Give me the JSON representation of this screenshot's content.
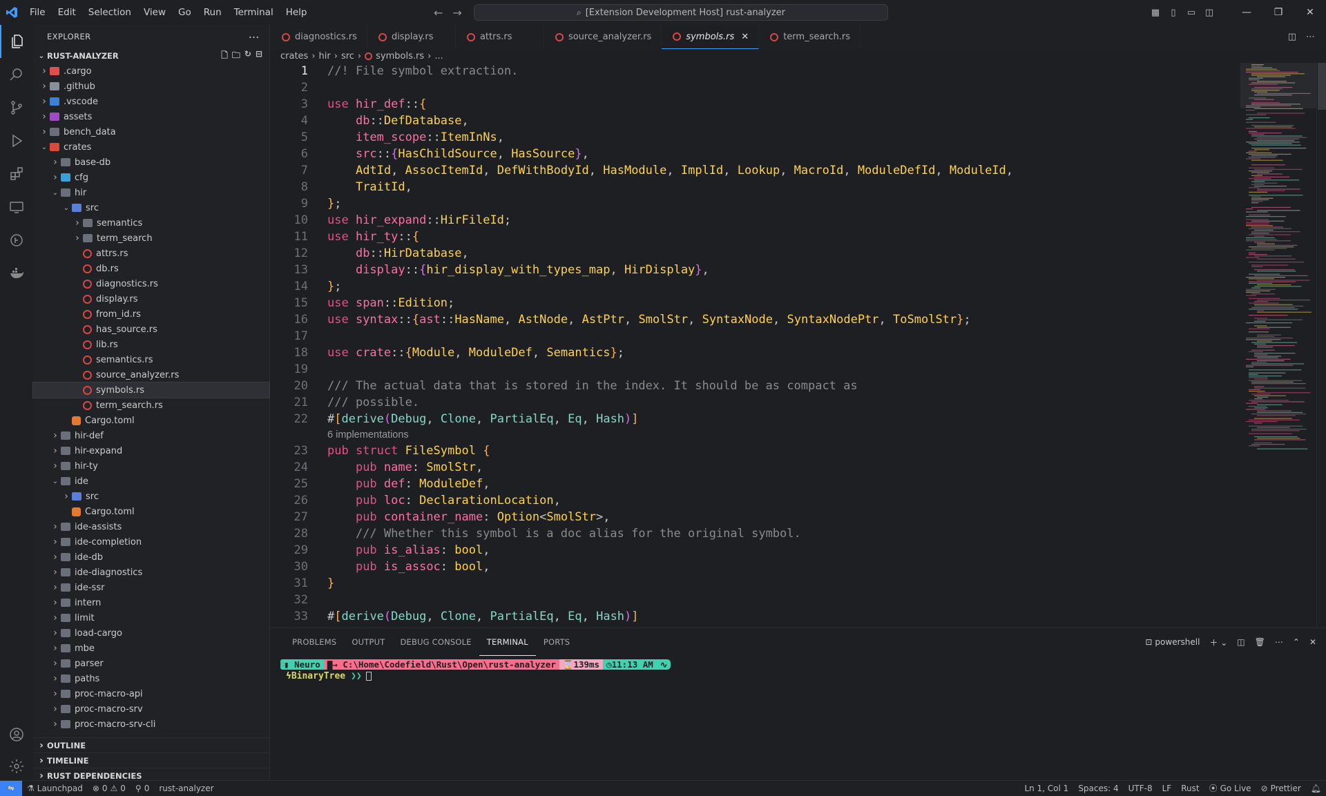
{
  "titlebar": {
    "menu": [
      "File",
      "Edit",
      "Selection",
      "View",
      "Go",
      "Run",
      "Terminal",
      "Help"
    ],
    "command_center": "[Extension Development Host] rust-analyzer"
  },
  "explorer": {
    "title": "EXPLORER",
    "root": "RUST-ANALYZER",
    "items": [
      {
        "label": ".cargo",
        "depth": 0,
        "kind": "folder",
        "open": false,
        "icon": "cargo"
      },
      {
        "label": ".github",
        "depth": 0,
        "kind": "folder",
        "open": false,
        "icon": "github"
      },
      {
        "label": ".vscode",
        "depth": 0,
        "kind": "folder",
        "open": false,
        "icon": "vscode"
      },
      {
        "label": "assets",
        "depth": 0,
        "kind": "folder",
        "open": false,
        "icon": "assets"
      },
      {
        "label": "bench_data",
        "depth": 0,
        "kind": "folder",
        "open": false,
        "icon": ""
      },
      {
        "label": "crates",
        "depth": 0,
        "kind": "folder",
        "open": true,
        "icon": "crates"
      },
      {
        "label": "base-db",
        "depth": 1,
        "kind": "folder",
        "open": false,
        "icon": ""
      },
      {
        "label": "cfg",
        "depth": 1,
        "kind": "folder",
        "open": false,
        "icon": "cfg"
      },
      {
        "label": "hir",
        "depth": 1,
        "kind": "folder",
        "open": true,
        "icon": ""
      },
      {
        "label": "src",
        "depth": 2,
        "kind": "folder",
        "open": true,
        "icon": "src"
      },
      {
        "label": "semantics",
        "depth": 3,
        "kind": "folder",
        "open": false,
        "icon": ""
      },
      {
        "label": "term_search",
        "depth": 3,
        "kind": "folder",
        "open": false,
        "icon": ""
      },
      {
        "label": "attrs.rs",
        "depth": 3,
        "kind": "rs"
      },
      {
        "label": "db.rs",
        "depth": 3,
        "kind": "rs"
      },
      {
        "label": "diagnostics.rs",
        "depth": 3,
        "kind": "rs"
      },
      {
        "label": "display.rs",
        "depth": 3,
        "kind": "rs"
      },
      {
        "label": "from_id.rs",
        "depth": 3,
        "kind": "rs"
      },
      {
        "label": "has_source.rs",
        "depth": 3,
        "kind": "rs"
      },
      {
        "label": "lib.rs",
        "depth": 3,
        "kind": "rs"
      },
      {
        "label": "semantics.rs",
        "depth": 3,
        "kind": "rs"
      },
      {
        "label": "source_analyzer.rs",
        "depth": 3,
        "kind": "rs"
      },
      {
        "label": "symbols.rs",
        "depth": 3,
        "kind": "rs",
        "selected": true
      },
      {
        "label": "term_search.rs",
        "depth": 3,
        "kind": "rs"
      },
      {
        "label": "Cargo.toml",
        "depth": 2,
        "kind": "toml"
      },
      {
        "label": "hir-def",
        "depth": 1,
        "kind": "folder",
        "open": false,
        "icon": ""
      },
      {
        "label": "hir-expand",
        "depth": 1,
        "kind": "folder",
        "open": false,
        "icon": ""
      },
      {
        "label": "hir-ty",
        "depth": 1,
        "kind": "folder",
        "open": false,
        "icon": ""
      },
      {
        "label": "ide",
        "depth": 1,
        "kind": "folder",
        "open": true,
        "icon": ""
      },
      {
        "label": "src",
        "depth": 2,
        "kind": "folder",
        "open": false,
        "icon": "src"
      },
      {
        "label": "Cargo.toml",
        "depth": 2,
        "kind": "toml"
      },
      {
        "label": "ide-assists",
        "depth": 1,
        "kind": "folder",
        "open": false,
        "icon": ""
      },
      {
        "label": "ide-completion",
        "depth": 1,
        "kind": "folder",
        "open": false,
        "icon": ""
      },
      {
        "label": "ide-db",
        "depth": 1,
        "kind": "folder",
        "open": false,
        "icon": ""
      },
      {
        "label": "ide-diagnostics",
        "depth": 1,
        "kind": "folder",
        "open": false,
        "icon": ""
      },
      {
        "label": "ide-ssr",
        "depth": 1,
        "kind": "folder",
        "open": false,
        "icon": ""
      },
      {
        "label": "intern",
        "depth": 1,
        "kind": "folder",
        "open": false,
        "icon": ""
      },
      {
        "label": "limit",
        "depth": 1,
        "kind": "folder",
        "open": false,
        "icon": ""
      },
      {
        "label": "load-cargo",
        "depth": 1,
        "kind": "folder",
        "open": false,
        "icon": ""
      },
      {
        "label": "mbe",
        "depth": 1,
        "kind": "folder",
        "open": false,
        "icon": ""
      },
      {
        "label": "parser",
        "depth": 1,
        "kind": "folder",
        "open": false,
        "icon": ""
      },
      {
        "label": "paths",
        "depth": 1,
        "kind": "folder",
        "open": false,
        "icon": ""
      },
      {
        "label": "proc-macro-api",
        "depth": 1,
        "kind": "folder",
        "open": false,
        "icon": ""
      },
      {
        "label": "proc-macro-srv",
        "depth": 1,
        "kind": "folder",
        "open": false,
        "icon": ""
      },
      {
        "label": "proc-macro-srv-cli",
        "depth": 1,
        "kind": "folder",
        "open": false,
        "icon": ""
      }
    ],
    "bottom_sections": [
      "OUTLINE",
      "TIMELINE",
      "RUST DEPENDENCIES"
    ]
  },
  "tabs": [
    {
      "label": "diagnostics.rs",
      "active": false
    },
    {
      "label": "display.rs",
      "active": false
    },
    {
      "label": "attrs.rs",
      "active": false
    },
    {
      "label": "source_analyzer.rs",
      "active": false
    },
    {
      "label": "symbols.rs",
      "active": true
    },
    {
      "label": "term_search.rs",
      "active": false
    }
  ],
  "breadcrumb": [
    "crates",
    "hir",
    "src",
    "symbols.rs",
    "..."
  ],
  "code_lens": "6 implementations",
  "editor_lines": [
    [
      1,
      [
        [
          "cm",
          "//! File symbol extraction."
        ]
      ]
    ],
    [
      2,
      []
    ],
    [
      3,
      [
        [
          "kw",
          "use "
        ],
        [
          "md",
          "hir_def"
        ],
        [
          "pu",
          "::"
        ],
        [
          "br",
          "{"
        ]
      ]
    ],
    [
      4,
      [
        [
          "pu",
          "    "
        ],
        [
          "md",
          "db"
        ],
        [
          "pu",
          "::"
        ],
        [
          "ty",
          "DefDatabase"
        ],
        [
          "pu",
          ","
        ]
      ]
    ],
    [
      5,
      [
        [
          "pu",
          "    "
        ],
        [
          "md",
          "item_scope"
        ],
        [
          "pu",
          "::"
        ],
        [
          "ty",
          "ItemInNs"
        ],
        [
          "pu",
          ","
        ]
      ]
    ],
    [
      6,
      [
        [
          "pu",
          "    "
        ],
        [
          "md",
          "src"
        ],
        [
          "pu",
          "::"
        ],
        [
          "br2",
          "{"
        ],
        [
          "ty",
          "HasChildSource"
        ],
        [
          "pu",
          ", "
        ],
        [
          "ty",
          "HasSource"
        ],
        [
          "br2",
          "}"
        ],
        [
          "pu",
          ","
        ]
      ]
    ],
    [
      7,
      [
        [
          "pu",
          "    "
        ],
        [
          "ty",
          "AdtId"
        ],
        [
          "pu",
          ", "
        ],
        [
          "ty",
          "AssocItemId"
        ],
        [
          "pu",
          ", "
        ],
        [
          "ty",
          "DefWithBodyId"
        ],
        [
          "pu",
          ", "
        ],
        [
          "ty",
          "HasModule"
        ],
        [
          "pu",
          ", "
        ],
        [
          "ty",
          "ImplId"
        ],
        [
          "pu",
          ", "
        ],
        [
          "ty",
          "Lookup"
        ],
        [
          "pu",
          ", "
        ],
        [
          "ty",
          "MacroId"
        ],
        [
          "pu",
          ", "
        ],
        [
          "ty",
          "ModuleDefId"
        ],
        [
          "pu",
          ", "
        ],
        [
          "ty",
          "ModuleId"
        ],
        [
          "pu",
          ","
        ]
      ]
    ],
    [
      8,
      [
        [
          "pu",
          "    "
        ],
        [
          "ty",
          "TraitId"
        ],
        [
          "pu",
          ","
        ]
      ]
    ],
    [
      9,
      [
        [
          "br",
          "}"
        ],
        [
          "pu",
          ";"
        ]
      ]
    ],
    [
      10,
      [
        [
          "kw",
          "use "
        ],
        [
          "md",
          "hir_expand"
        ],
        [
          "pu",
          "::"
        ],
        [
          "ty",
          "HirFileId"
        ],
        [
          "pu",
          ";"
        ]
      ]
    ],
    [
      11,
      [
        [
          "kw",
          "use "
        ],
        [
          "md",
          "hir_ty"
        ],
        [
          "pu",
          "::"
        ],
        [
          "br",
          "{"
        ]
      ]
    ],
    [
      12,
      [
        [
          "pu",
          "    "
        ],
        [
          "md",
          "db"
        ],
        [
          "pu",
          "::"
        ],
        [
          "ty",
          "HirDatabase"
        ],
        [
          "pu",
          ","
        ]
      ]
    ],
    [
      13,
      [
        [
          "pu",
          "    "
        ],
        [
          "md",
          "display"
        ],
        [
          "pu",
          "::"
        ],
        [
          "br2",
          "{"
        ],
        [
          "fn",
          "hir_display_with_types_map"
        ],
        [
          "pu",
          ", "
        ],
        [
          "ty",
          "HirDisplay"
        ],
        [
          "br2",
          "}"
        ],
        [
          "pu",
          ","
        ]
      ]
    ],
    [
      14,
      [
        [
          "br",
          "}"
        ],
        [
          "pu",
          ";"
        ]
      ]
    ],
    [
      15,
      [
        [
          "kw",
          "use "
        ],
        [
          "md",
          "span"
        ],
        [
          "pu",
          "::"
        ],
        [
          "ty",
          "Edition"
        ],
        [
          "pu",
          ";"
        ]
      ]
    ],
    [
      16,
      [
        [
          "kw",
          "use "
        ],
        [
          "md",
          "syntax"
        ],
        [
          "pu",
          "::"
        ],
        [
          "br",
          "{"
        ],
        [
          "md",
          "ast"
        ],
        [
          "pu",
          "::"
        ],
        [
          "ty",
          "HasName"
        ],
        [
          "pu",
          ", "
        ],
        [
          "ty",
          "AstNode"
        ],
        [
          "pu",
          ", "
        ],
        [
          "ty",
          "AstPtr"
        ],
        [
          "pu",
          ", "
        ],
        [
          "ty",
          "SmolStr"
        ],
        [
          "pu",
          ", "
        ],
        [
          "ty",
          "SyntaxNode"
        ],
        [
          "pu",
          ", "
        ],
        [
          "ty",
          "SyntaxNodePtr"
        ],
        [
          "pu",
          ", "
        ],
        [
          "ty",
          "ToSmolStr"
        ],
        [
          "br",
          "}"
        ],
        [
          "pu",
          ";"
        ]
      ]
    ],
    [
      17,
      []
    ],
    [
      18,
      [
        [
          "kw",
          "use "
        ],
        [
          "md",
          "crate"
        ],
        [
          "pu",
          "::"
        ],
        [
          "br",
          "{"
        ],
        [
          "ty",
          "Module"
        ],
        [
          "pu",
          ", "
        ],
        [
          "ty",
          "ModuleDef"
        ],
        [
          "pu",
          ", "
        ],
        [
          "ty",
          "Semantics"
        ],
        [
          "br",
          "}"
        ],
        [
          "pu",
          ";"
        ]
      ]
    ],
    [
      19,
      []
    ],
    [
      20,
      [
        [
          "cm",
          "/// The actual data that is stored in the index. It should be as compact as"
        ]
      ]
    ],
    [
      21,
      [
        [
          "cm",
          "/// possible."
        ]
      ]
    ],
    [
      22,
      [
        [
          "pu",
          "#"
        ],
        [
          "br",
          "["
        ],
        [
          "at",
          "derive"
        ],
        [
          "br2",
          "("
        ],
        [
          "at",
          "Debug"
        ],
        [
          "pu",
          ", "
        ],
        [
          "at",
          "Clone"
        ],
        [
          "pu",
          ", "
        ],
        [
          "at",
          "PartialEq"
        ],
        [
          "pu",
          ", "
        ],
        [
          "at",
          "Eq"
        ],
        [
          "pu",
          ", "
        ],
        [
          "at",
          "Hash"
        ],
        [
          "br2",
          ")"
        ],
        [
          "br",
          "]"
        ]
      ]
    ],
    [
      23,
      [
        [
          "kw",
          "pub struct "
        ],
        [
          "ty",
          "FileSymbol "
        ],
        [
          "br",
          "{"
        ]
      ]
    ],
    [
      24,
      [
        [
          "pu",
          "    "
        ],
        [
          "kw",
          "pub "
        ],
        [
          "md",
          "name"
        ],
        [
          "pu",
          ": "
        ],
        [
          "ty",
          "SmolStr"
        ],
        [
          "pu",
          ","
        ]
      ]
    ],
    [
      25,
      [
        [
          "pu",
          "    "
        ],
        [
          "kw",
          "pub "
        ],
        [
          "md",
          "def"
        ],
        [
          "pu",
          ": "
        ],
        [
          "ty",
          "ModuleDef"
        ],
        [
          "pu",
          ","
        ]
      ]
    ],
    [
      26,
      [
        [
          "pu",
          "    "
        ],
        [
          "kw",
          "pub "
        ],
        [
          "md",
          "loc"
        ],
        [
          "pu",
          ": "
        ],
        [
          "ty",
          "DeclarationLocation"
        ],
        [
          "pu",
          ","
        ]
      ]
    ],
    [
      27,
      [
        [
          "pu",
          "    "
        ],
        [
          "kw",
          "pub "
        ],
        [
          "md",
          "container_name"
        ],
        [
          "pu",
          ": "
        ],
        [
          "ty",
          "Option"
        ],
        [
          "pu",
          "<"
        ],
        [
          "ty",
          "SmolStr"
        ],
        [
          "pu",
          ">,"
        ]
      ]
    ],
    [
      28,
      [
        [
          "pu",
          "    "
        ],
        [
          "cm",
          "/// Whether this symbol is a doc alias for the original symbol."
        ]
      ]
    ],
    [
      29,
      [
        [
          "pu",
          "    "
        ],
        [
          "kw",
          "pub "
        ],
        [
          "md",
          "is_alias"
        ],
        [
          "pu",
          ": "
        ],
        [
          "ty",
          "bool"
        ],
        [
          "pu",
          ","
        ]
      ]
    ],
    [
      30,
      [
        [
          "pu",
          "    "
        ],
        [
          "kw",
          "pub "
        ],
        [
          "md",
          "is_assoc"
        ],
        [
          "pu",
          ": "
        ],
        [
          "ty",
          "bool"
        ],
        [
          "pu",
          ","
        ]
      ]
    ],
    [
      31,
      [
        [
          "br",
          "}"
        ]
      ]
    ],
    [
      32,
      []
    ],
    [
      33,
      [
        [
          "pu",
          "#"
        ],
        [
          "br",
          "["
        ],
        [
          "at",
          "derive"
        ],
        [
          "br2",
          "("
        ],
        [
          "at",
          "Debug"
        ],
        [
          "pu",
          ", "
        ],
        [
          "at",
          "Clone"
        ],
        [
          "pu",
          ", "
        ],
        [
          "at",
          "PartialEq"
        ],
        [
          "pu",
          ", "
        ],
        [
          "at",
          "Eq"
        ],
        [
          "pu",
          ", "
        ],
        [
          "at",
          "Hash"
        ],
        [
          "br2",
          ")"
        ],
        [
          "br",
          "]"
        ]
      ]
    ]
  ],
  "panel": {
    "tabs": [
      "PROBLEMS",
      "OUTPUT",
      "DEBUG CONSOLE",
      "TERMINAL",
      "PORTS"
    ],
    "active_tab": "TERMINAL",
    "shell": "powershell"
  },
  "terminal": {
    "prompt_user": "Neuro",
    "prompt_path": "C:\\Home\\Codefield\\Rust\\Open\\rust-analyzer",
    "prompt_duration": "139ms",
    "prompt_time": "11:13 AM",
    "line2_label": "BinaryTree",
    "line2_arrows": "❯❯"
  },
  "statusbar": {
    "launchpad": "Launchpad",
    "errors": "0",
    "warnings": "0",
    "ports": "0",
    "server": "rust-analyzer",
    "position": "Ln 1, Col 1",
    "spaces": "Spaces: 4",
    "encoding": "UTF-8",
    "eol": "LF",
    "language": "Rust",
    "golive": "Go Live",
    "prettier": "Prettier"
  },
  "colors": {
    "accent": "#3b9cff",
    "keyword": "#e84f8a",
    "type": "#ffd24a",
    "comment": "#8a8a8a",
    "rust_icon": "#d84646"
  }
}
